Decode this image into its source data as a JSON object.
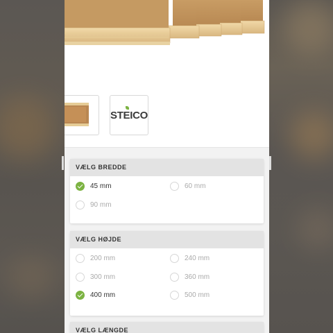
{
  "product_thumbnails": [
    {
      "name": "wood-beam-thumbnail"
    },
    {
      "name": "steico-logo",
      "text": "STEICO"
    }
  ],
  "options": {
    "width": {
      "title": "VÆLG BREDDE",
      "choices": [
        {
          "label": "45 mm",
          "selected": true
        },
        {
          "label": "60 mm",
          "selected": false
        },
        {
          "label": "90 mm",
          "selected": false
        }
      ]
    },
    "height": {
      "title": "VÆLG HØJDE",
      "choices": [
        {
          "label": "200 mm",
          "selected": false
        },
        {
          "label": "240 mm",
          "selected": false
        },
        {
          "label": "300 mm",
          "selected": false
        },
        {
          "label": "360 mm",
          "selected": false
        },
        {
          "label": "400 mm",
          "selected": true
        },
        {
          "label": "500 mm",
          "selected": false
        }
      ]
    },
    "length": {
      "title": "VÆLG LÆNGDE"
    }
  },
  "colors": {
    "accent": "#7cb342",
    "card_header": "#e3e3e3",
    "backdrop": "#5a5652"
  }
}
